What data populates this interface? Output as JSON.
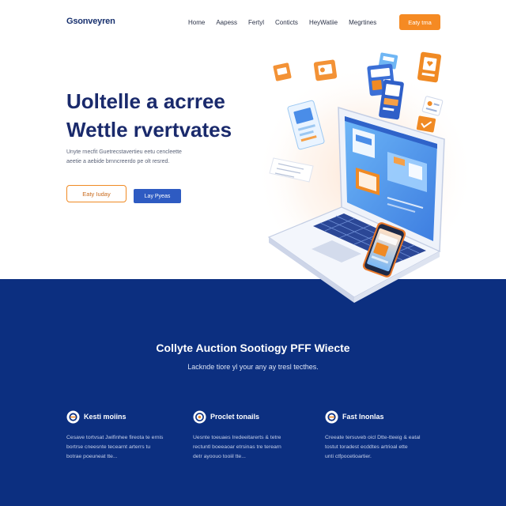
{
  "colors": {
    "accent_orange": "#f08a24",
    "navy_text": "#1a2a6c",
    "band_blue": "#0c2f80",
    "button_blue": "#2e5bc2"
  },
  "header": {
    "logo": "Gsonveyren",
    "nav": [
      "Home",
      "Aapess",
      "Fertyl",
      "Conticts",
      "HeyWatiie",
      "Megrtines"
    ],
    "cta": "Eaty tma"
  },
  "hero": {
    "title": [
      "Uoltelle a acrree",
      "Wettle rvertvates"
    ],
    "paragraph": [
      "Unyte rnecfit Guetrecstavertieu eetu cencleette",
      "aeetie a aebide brnncreerdo pe olt resred."
    ],
    "primary_button": "Eaty Iuday",
    "secondary_button": "Lay Pyeas"
  },
  "features_section": {
    "title": "Collyte Auction Sootiogy PFF Wiecte",
    "subtitle": "Lacknde tiore yl your any ay tresl tecthes.",
    "features": [
      {
        "icon": "edit-circle-icon",
        "title": "Kesti moiins",
        "description": [
          "Cesave tortvsat Jwifinhee fireota te ernis",
          "bortrse cneesnte tecearnt arterrs tu",
          "botrae poeuneat tte..."
        ]
      },
      {
        "icon": "target-circle-icon",
        "title": "Proclet tonails",
        "description": [
          "Uesnte toeuaes Iredeeitarerts & tetre",
          "rectuntl boeeaoar etrsinas tre terearn",
          "detr ayoouo tooiil tte..."
        ]
      },
      {
        "icon": "edit-circle-icon",
        "title": "Fast Inonlas",
        "description": [
          "Creeate tersuveb oicl Dtte-tteeig & eatal",
          "tostut toradest ecddtes artrioal ette",
          "unti ctfpocetioartier."
        ]
      }
    ]
  }
}
